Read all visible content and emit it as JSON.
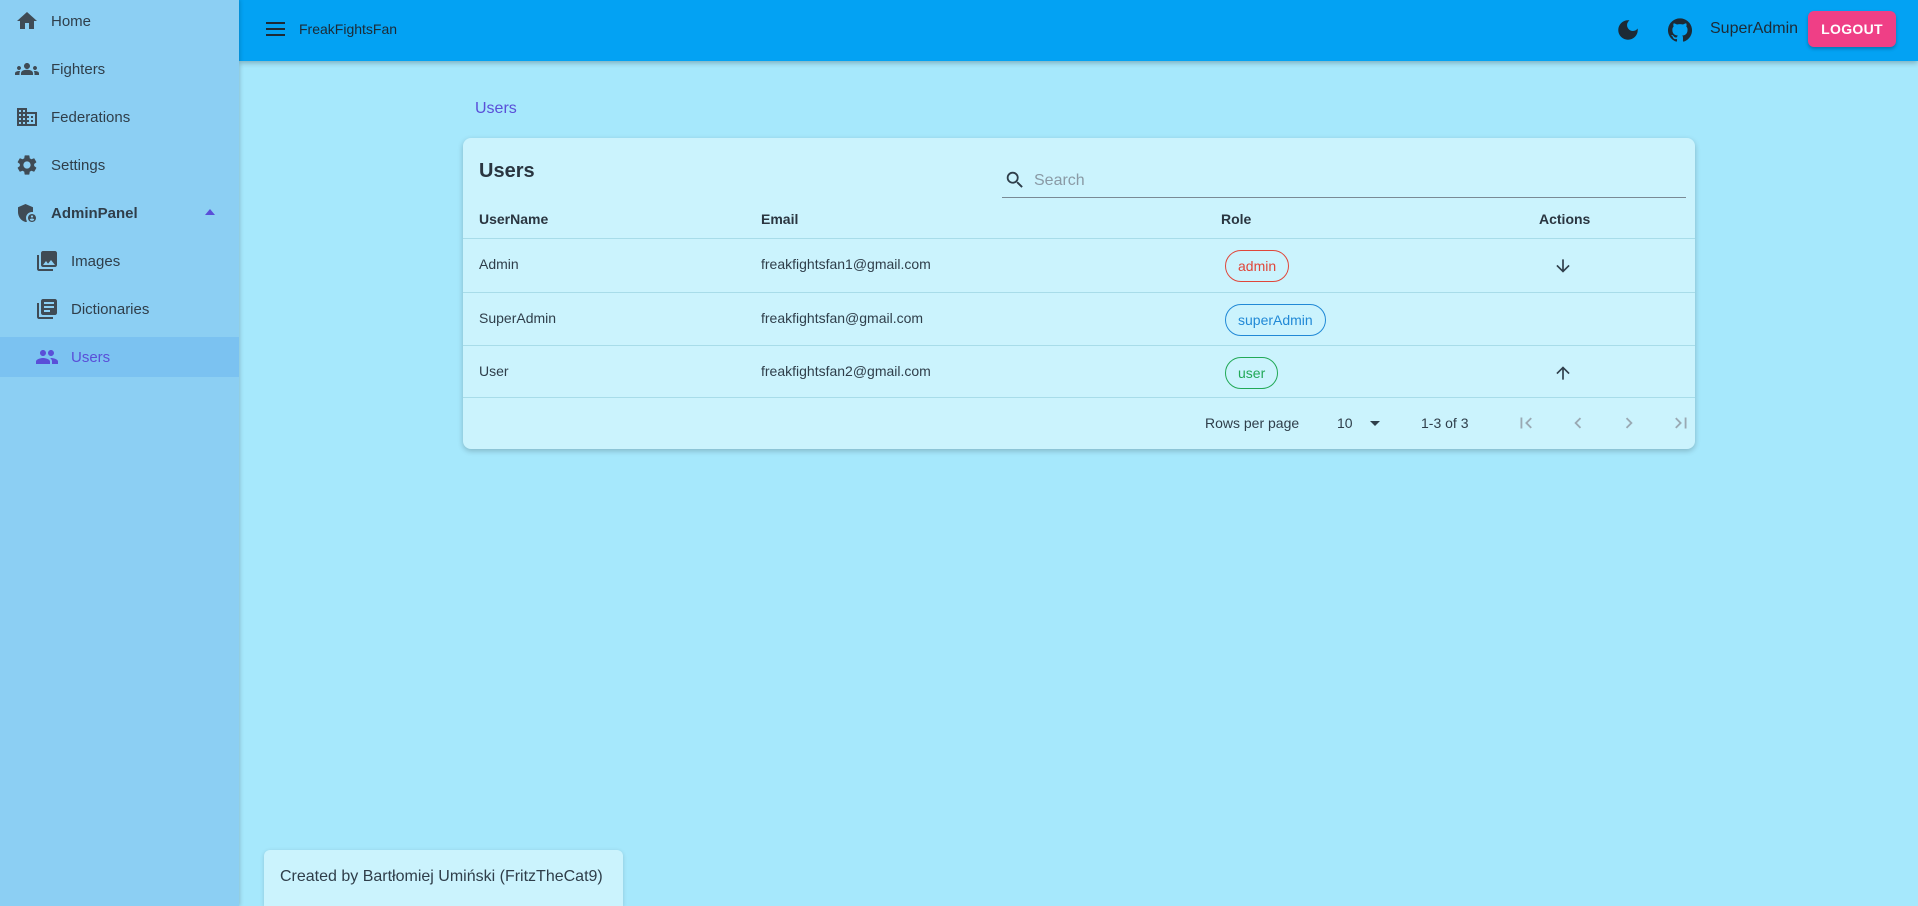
{
  "app": {
    "title": "FreakFightsFan"
  },
  "sidebar": {
    "items": [
      {
        "label": "Home",
        "icon": "home-icon"
      },
      {
        "label": "Fighters",
        "icon": "groups-icon"
      },
      {
        "label": "Federations",
        "icon": "building-icon"
      },
      {
        "label": "Settings",
        "icon": "gear-icon"
      },
      {
        "label": "AdminPanel",
        "icon": "admin-shield-icon",
        "expanded": true
      },
      {
        "label": "Images",
        "icon": "images-icon"
      },
      {
        "label": "Dictionaries",
        "icon": "library-books-icon"
      },
      {
        "label": "Users",
        "icon": "people-icon",
        "active": true
      }
    ]
  },
  "header": {
    "theme_icon": "moon-icon",
    "github_icon": "github-icon",
    "user_name": "SuperAdmin",
    "logout_label": "LOGOUT"
  },
  "breadcrumb": {
    "current": "Users"
  },
  "users_table": {
    "title": "Users",
    "search": {
      "placeholder": "Search",
      "value": ""
    },
    "columns": [
      "UserName",
      "Email",
      "Role",
      "Actions"
    ],
    "rows": [
      {
        "username": "Admin",
        "email": "freakfightsfan1@gmail.com",
        "role": "admin",
        "action": "arrow-down-icon"
      },
      {
        "username": "SuperAdmin",
        "email": "freakfightsfan@gmail.com",
        "role": "superAdmin",
        "action": ""
      },
      {
        "username": "User",
        "email": "freakfightsfan2@gmail.com",
        "role": "user",
        "action": "arrow-up-icon"
      }
    ],
    "pagination": {
      "rows_per_page_label": "Rows per page",
      "rows_per_page": "10",
      "range": "1-3 of 3"
    },
    "colors": {
      "admin": "#e0463a",
      "superAdmin": "#2189d6",
      "user": "#22a957"
    }
  },
  "footer": {
    "credit": "Created by Bartłomiej Umiński (FritzTheCat9)"
  },
  "colors": {
    "appbar": "#03a2f3",
    "sidebar": "#8ccff3",
    "background": "#a6e8fc",
    "accent": "#5a4fd8",
    "logout": "#ef3f86"
  }
}
